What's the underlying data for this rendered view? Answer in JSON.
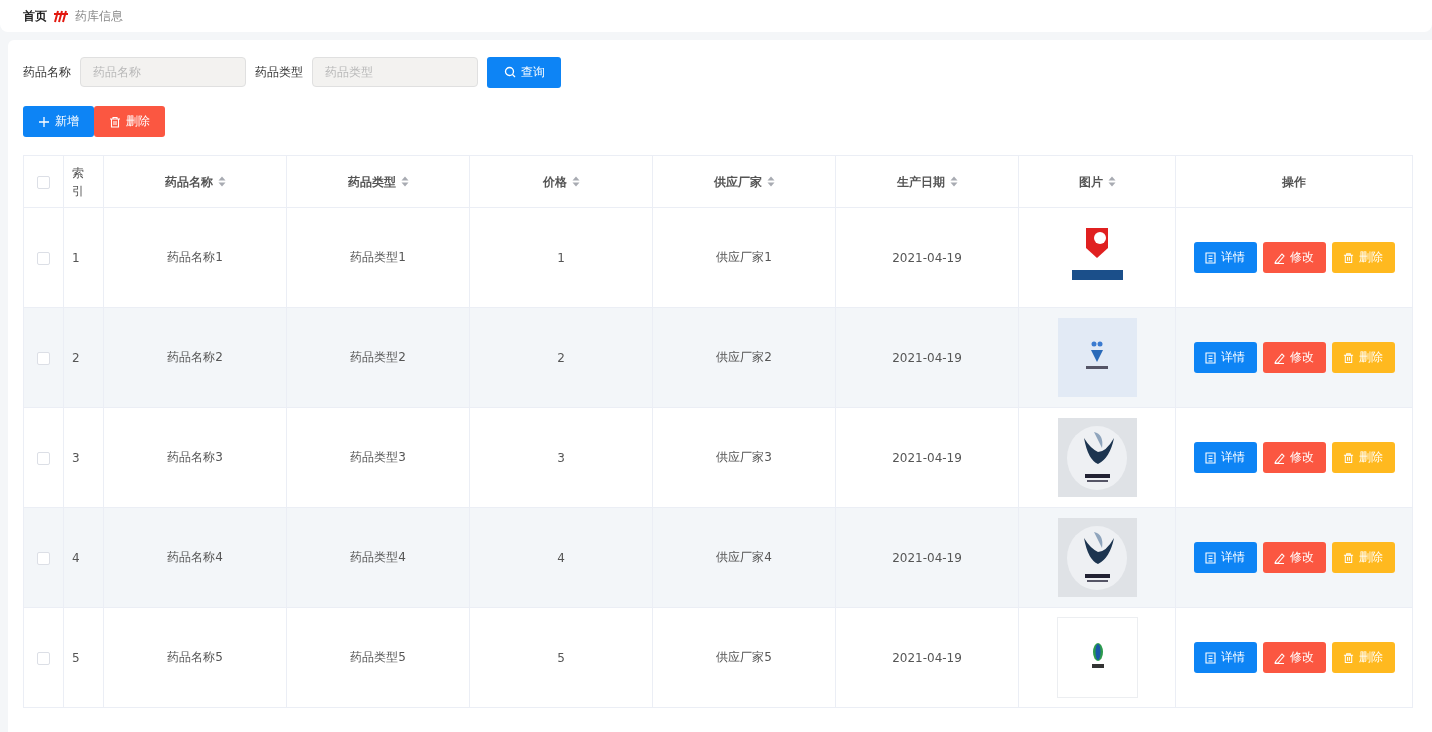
{
  "breadcrumb": {
    "home": "首页",
    "current": "药库信息"
  },
  "search": {
    "fields": [
      {
        "label": "药品名称",
        "placeholder": "药品名称"
      },
      {
        "label": "药品类型",
        "placeholder": "药品类型"
      }
    ],
    "button": "查询"
  },
  "actions": [
    {
      "kind": "add",
      "label": "新增"
    },
    {
      "kind": "delete",
      "label": "删除"
    }
  ],
  "table": {
    "all_checked": false,
    "columns": [
      {
        "label": "索引",
        "sortable": false
      },
      {
        "label": "药品名称",
        "sortable": true
      },
      {
        "label": "药品类型",
        "sortable": true
      },
      {
        "label": "价格",
        "sortable": true
      },
      {
        "label": "供应厂家",
        "sortable": true
      },
      {
        "label": "生产日期",
        "sortable": true
      },
      {
        "label": "图片",
        "sortable": true
      },
      {
        "label": "操作",
        "sortable": false
      }
    ],
    "rows": [
      {
        "checked": false,
        "cells": [
          "1",
          "药品名称1",
          "药品类型1",
          "1",
          "供应厂家1",
          "2021-04-19"
        ],
        "buttons": [
          {
            "kind": "detail",
            "label": "详情"
          },
          {
            "kind": "edit",
            "label": "修改"
          },
          {
            "kind": "delete",
            "label": "删除"
          }
        ]
      },
      {
        "checked": false,
        "cells": [
          "2",
          "药品名称2",
          "药品类型2",
          "2",
          "供应厂家2",
          "2021-04-19"
        ],
        "buttons": [
          {
            "kind": "detail",
            "label": "详情"
          },
          {
            "kind": "edit",
            "label": "修改"
          },
          {
            "kind": "delete",
            "label": "删除"
          }
        ]
      },
      {
        "checked": false,
        "cells": [
          "3",
          "药品名称3",
          "药品类型3",
          "3",
          "供应厂家3",
          "2021-04-19"
        ],
        "buttons": [
          {
            "kind": "detail",
            "label": "详情"
          },
          {
            "kind": "edit",
            "label": "修改"
          },
          {
            "kind": "delete",
            "label": "删除"
          }
        ]
      },
      {
        "checked": false,
        "cells": [
          "4",
          "药品名称4",
          "药品类型4",
          "4",
          "供应厂家4",
          "2021-04-19"
        ],
        "buttons": [
          {
            "kind": "detail",
            "label": "详情"
          },
          {
            "kind": "edit",
            "label": "修改"
          },
          {
            "kind": "delete",
            "label": "删除"
          }
        ]
      },
      {
        "checked": false,
        "cells": [
          "5",
          "药品名称5",
          "药品类型5",
          "5",
          "供应厂家5",
          "2021-04-19"
        ],
        "buttons": [
          {
            "kind": "detail",
            "label": "详情"
          },
          {
            "kind": "edit",
            "label": "修改"
          },
          {
            "kind": "delete",
            "label": "删除"
          }
        ]
      }
    ]
  }
}
